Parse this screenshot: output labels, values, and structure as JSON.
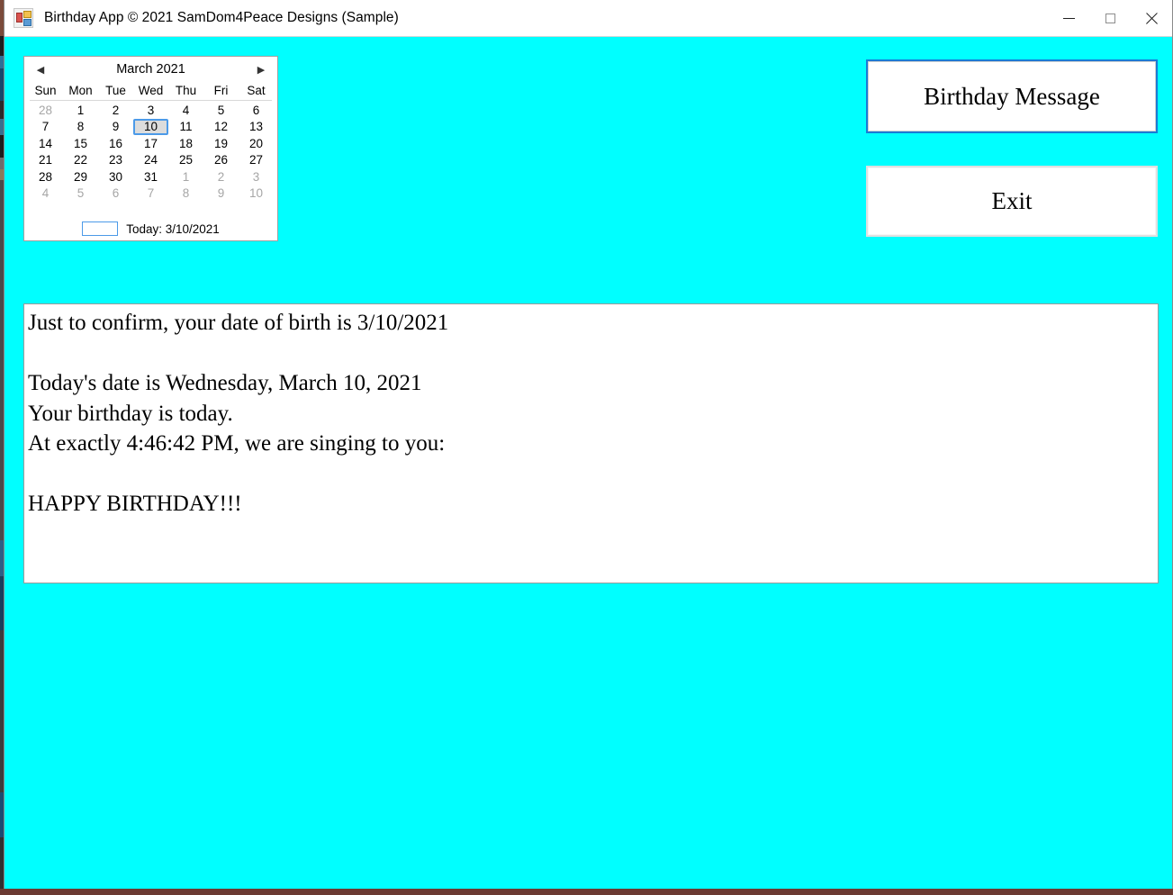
{
  "window": {
    "title": "Birthday App © 2021 SamDom4Peace Designs (Sample)",
    "icon": "winforms-app-icon",
    "background_color": "#00ffff",
    "controls": {
      "minimize": "minimize-icon",
      "maximize": "maximize-icon",
      "close": "close-icon"
    }
  },
  "calendar": {
    "prev_arrow": "◀",
    "next_arrow": "▶",
    "title": "March 2021",
    "weekdays": [
      "Sun",
      "Mon",
      "Tue",
      "Wed",
      "Thu",
      "Fri",
      "Sat"
    ],
    "weeks": [
      [
        {
          "n": "28",
          "other": true,
          "selected": false
        },
        {
          "n": "1",
          "other": false,
          "selected": false
        },
        {
          "n": "2",
          "other": false,
          "selected": false
        },
        {
          "n": "3",
          "other": false,
          "selected": false
        },
        {
          "n": "4",
          "other": false,
          "selected": false
        },
        {
          "n": "5",
          "other": false,
          "selected": false
        },
        {
          "n": "6",
          "other": false,
          "selected": false
        }
      ],
      [
        {
          "n": "7",
          "other": false,
          "selected": false
        },
        {
          "n": "8",
          "other": false,
          "selected": false
        },
        {
          "n": "9",
          "other": false,
          "selected": false
        },
        {
          "n": "10",
          "other": false,
          "selected": true
        },
        {
          "n": "11",
          "other": false,
          "selected": false
        },
        {
          "n": "12",
          "other": false,
          "selected": false
        },
        {
          "n": "13",
          "other": false,
          "selected": false
        }
      ],
      [
        {
          "n": "14",
          "other": false,
          "selected": false
        },
        {
          "n": "15",
          "other": false,
          "selected": false
        },
        {
          "n": "16",
          "other": false,
          "selected": false
        },
        {
          "n": "17",
          "other": false,
          "selected": false
        },
        {
          "n": "18",
          "other": false,
          "selected": false
        },
        {
          "n": "19",
          "other": false,
          "selected": false
        },
        {
          "n": "20",
          "other": false,
          "selected": false
        }
      ],
      [
        {
          "n": "21",
          "other": false,
          "selected": false
        },
        {
          "n": "22",
          "other": false,
          "selected": false
        },
        {
          "n": "23",
          "other": false,
          "selected": false
        },
        {
          "n": "24",
          "other": false,
          "selected": false
        },
        {
          "n": "25",
          "other": false,
          "selected": false
        },
        {
          "n": "26",
          "other": false,
          "selected": false
        },
        {
          "n": "27",
          "other": false,
          "selected": false
        }
      ],
      [
        {
          "n": "28",
          "other": false,
          "selected": false
        },
        {
          "n": "29",
          "other": false,
          "selected": false
        },
        {
          "n": "30",
          "other": false,
          "selected": false
        },
        {
          "n": "31",
          "other": false,
          "selected": false
        },
        {
          "n": "1",
          "other": true,
          "selected": false
        },
        {
          "n": "2",
          "other": true,
          "selected": false
        },
        {
          "n": "3",
          "other": true,
          "selected": false
        }
      ],
      [
        {
          "n": "4",
          "other": true,
          "selected": false
        },
        {
          "n": "5",
          "other": true,
          "selected": false
        },
        {
          "n": "6",
          "other": true,
          "selected": false
        },
        {
          "n": "7",
          "other": true,
          "selected": false
        },
        {
          "n": "8",
          "other": true,
          "selected": false
        },
        {
          "n": "9",
          "other": true,
          "selected": false
        },
        {
          "n": "10",
          "other": true,
          "selected": false
        }
      ]
    ],
    "today_label": "Today: 3/10/2021",
    "selected_date": "3/10/2021",
    "selection_border_color": "#4c9ae8"
  },
  "buttons": {
    "birthday_message": "Birthday Message",
    "exit": "Exit",
    "focus_border_color": "#1a7bd4"
  },
  "output": {
    "text": "Just to confirm, your date of birth is 3/10/2021\n\nToday's date is Wednesday, March 10, 2021\nYour birthday is today.\nAt exactly 4:46:42 PM, we are singing to you:\n\nHAPPY BIRTHDAY!!!"
  }
}
